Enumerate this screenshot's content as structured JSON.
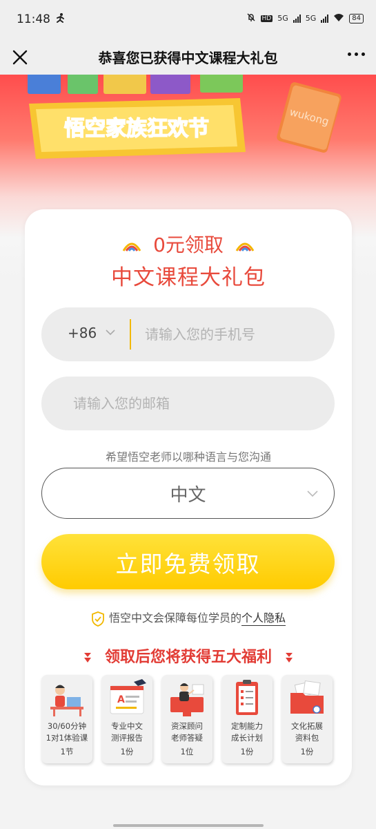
{
  "status_bar": {
    "time": "11:48",
    "hd_label": "HD",
    "net1": "5G",
    "net2": "5G",
    "battery": "84"
  },
  "nav": {
    "title": "恭喜您已获得中文课程大礼包"
  },
  "banner": {
    "festival_text": "悟空家族狂欢节",
    "book_text": "wukong"
  },
  "offer": {
    "headline": "0元领取",
    "subheadline": "中文课程大礼包"
  },
  "form": {
    "country_code": "+86",
    "phone_placeholder": "请输入您的手机号",
    "email_placeholder": "请输入您的邮箱",
    "language_prompt": "希望悟空老师以哪种语言与您沟通",
    "language_value": "中文",
    "submit_label": "立即免费领取"
  },
  "privacy": {
    "text": "悟空中文会保障每位学员的",
    "link": "个人隐私"
  },
  "benefits": {
    "title": "领取后您将获得五大福利",
    "items": [
      {
        "line1": "30/60分钟",
        "line2": "1对1体验课",
        "count": "1节",
        "icon": "teacher-laptop-icon"
      },
      {
        "line1": "专业中文",
        "line2": "测评报告",
        "count": "1份",
        "icon": "report-icon"
      },
      {
        "line1": "资深顾问",
        "line2": "老师答疑",
        "count": "1位",
        "icon": "advisor-icon"
      },
      {
        "line1": "定制能力",
        "line2": "成长计划",
        "count": "1份",
        "icon": "clipboard-plan-icon"
      },
      {
        "line1": "文化拓展",
        "line2": "资料包",
        "count": "1份",
        "icon": "folder-materials-icon"
      }
    ]
  },
  "colors": {
    "accent_red": "#e84a3c",
    "cta_yellow": "#ffcb00",
    "banner_red": "#ff4d4d"
  }
}
